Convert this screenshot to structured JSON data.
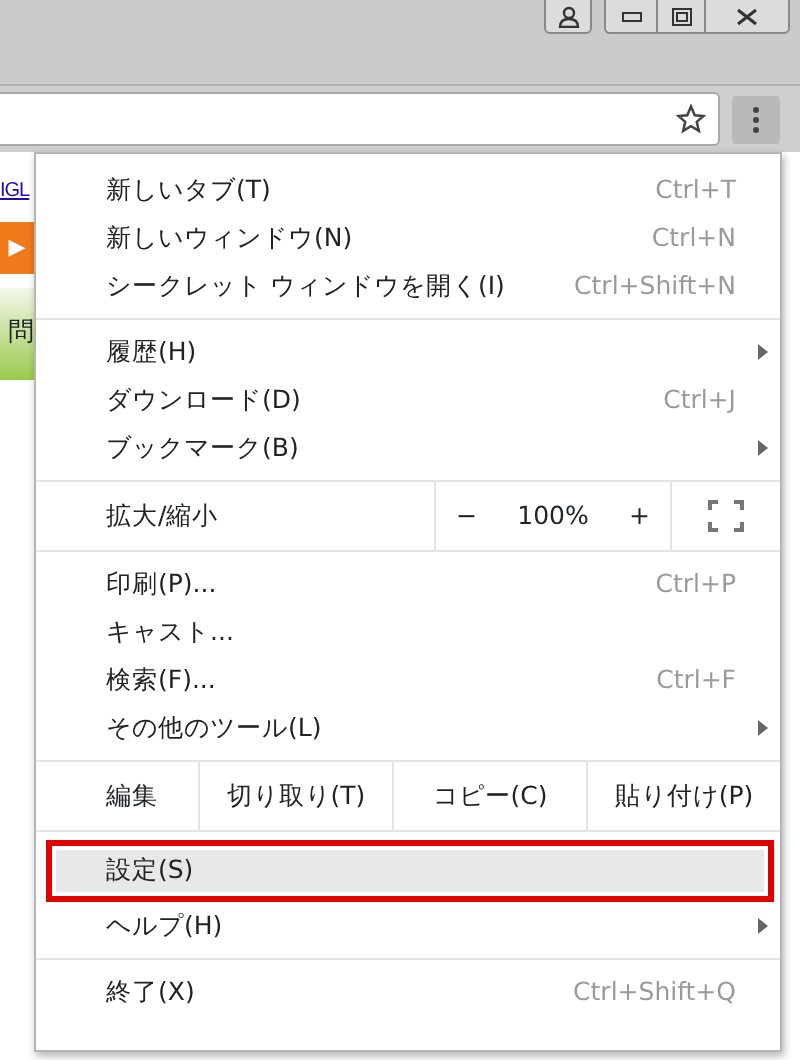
{
  "page": {
    "link_text": "IGL",
    "play_glyph": "▶",
    "banner_text": "問"
  },
  "menu": {
    "sections": [
      [
        {
          "kind": "item",
          "label": "新しいタブ(T)",
          "shortcut": "Ctrl+T",
          "submenu": false,
          "selected": false,
          "outlined": false
        },
        {
          "kind": "item",
          "label": "新しいウィンドウ(N)",
          "shortcut": "Ctrl+N",
          "submenu": false,
          "selected": false,
          "outlined": false
        },
        {
          "kind": "item",
          "label": "シークレット ウィンドウを開く(I)",
          "shortcut": "Ctrl+Shift+N",
          "submenu": false,
          "selected": false,
          "outlined": false
        }
      ],
      [
        {
          "kind": "item",
          "label": "履歴(H)",
          "submenu": true,
          "selected": false,
          "outlined": false
        },
        {
          "kind": "item",
          "label": "ダウンロード(D)",
          "shortcut": "Ctrl+J",
          "submenu": false,
          "selected": false,
          "outlined": false
        },
        {
          "kind": "item",
          "label": "ブックマーク(B)",
          "submenu": true,
          "selected": false,
          "outlined": false
        }
      ],
      [
        {
          "kind": "zoom",
          "label": "拡大/縮小",
          "minus": "−",
          "value": "100%",
          "plus": "+"
        }
      ],
      [
        {
          "kind": "item",
          "label": "印刷(P)...",
          "shortcut": "Ctrl+P",
          "submenu": false,
          "selected": false,
          "outlined": false
        },
        {
          "kind": "item",
          "label": "キャスト...",
          "submenu": false,
          "selected": false,
          "outlined": false
        },
        {
          "kind": "item",
          "label": "検索(F)...",
          "shortcut": "Ctrl+F",
          "submenu": false,
          "selected": false,
          "outlined": false
        },
        {
          "kind": "item",
          "label": "その他のツール(L)",
          "submenu": true,
          "selected": false,
          "outlined": false
        }
      ],
      [
        {
          "kind": "edit",
          "label": "編集",
          "buttons": [
            "切り取り(T)",
            "コピー(C)",
            "貼り付け(P)"
          ]
        }
      ],
      [
        {
          "kind": "item",
          "label": "設定(S)",
          "submenu": false,
          "selected": true,
          "outlined": true
        },
        {
          "kind": "item",
          "label": "ヘルプ(H)",
          "submenu": true,
          "selected": false,
          "outlined": false
        }
      ],
      [
        {
          "kind": "item",
          "label": "終了(X)",
          "shortcut": "Ctrl+Shift+Q",
          "submenu": false,
          "selected": false,
          "outlined": false
        }
      ]
    ]
  }
}
